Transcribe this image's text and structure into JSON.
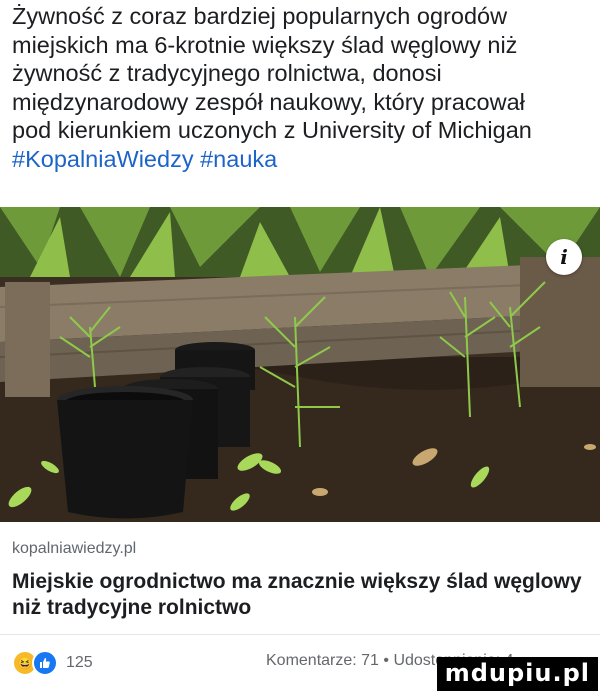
{
  "post": {
    "text_lines": [
      "Żywność z coraz bardziej popularnych ogrodów",
      "miejskich ma 6-krotnie większy ślad węglowy niż",
      "żywność z tradycyjnego rolnictwa, donosi",
      "międzynarodowy zespół naukowy, który pracował",
      "pod kierunkiem uczonych z University of Michigan"
    ],
    "hashtags": [
      "#KopalniaWiedzy",
      "#nauka"
    ]
  },
  "image": {
    "info_label": "i"
  },
  "link": {
    "domain": "kopalniawiedzy.pl",
    "title": "Miejskie ogrodnictwo ma znacznie większy ślad węglowy niż tradycyjne rolnictwo"
  },
  "stats": {
    "reaction_count": "125",
    "comments_shares": "Komentarze: 71 • Udostępnienia: 4"
  },
  "watermark": "mdupiu.pl",
  "colors": {
    "hashtag": "#1d64c8",
    "like": "#1877f2",
    "haha": "#f7b928"
  }
}
